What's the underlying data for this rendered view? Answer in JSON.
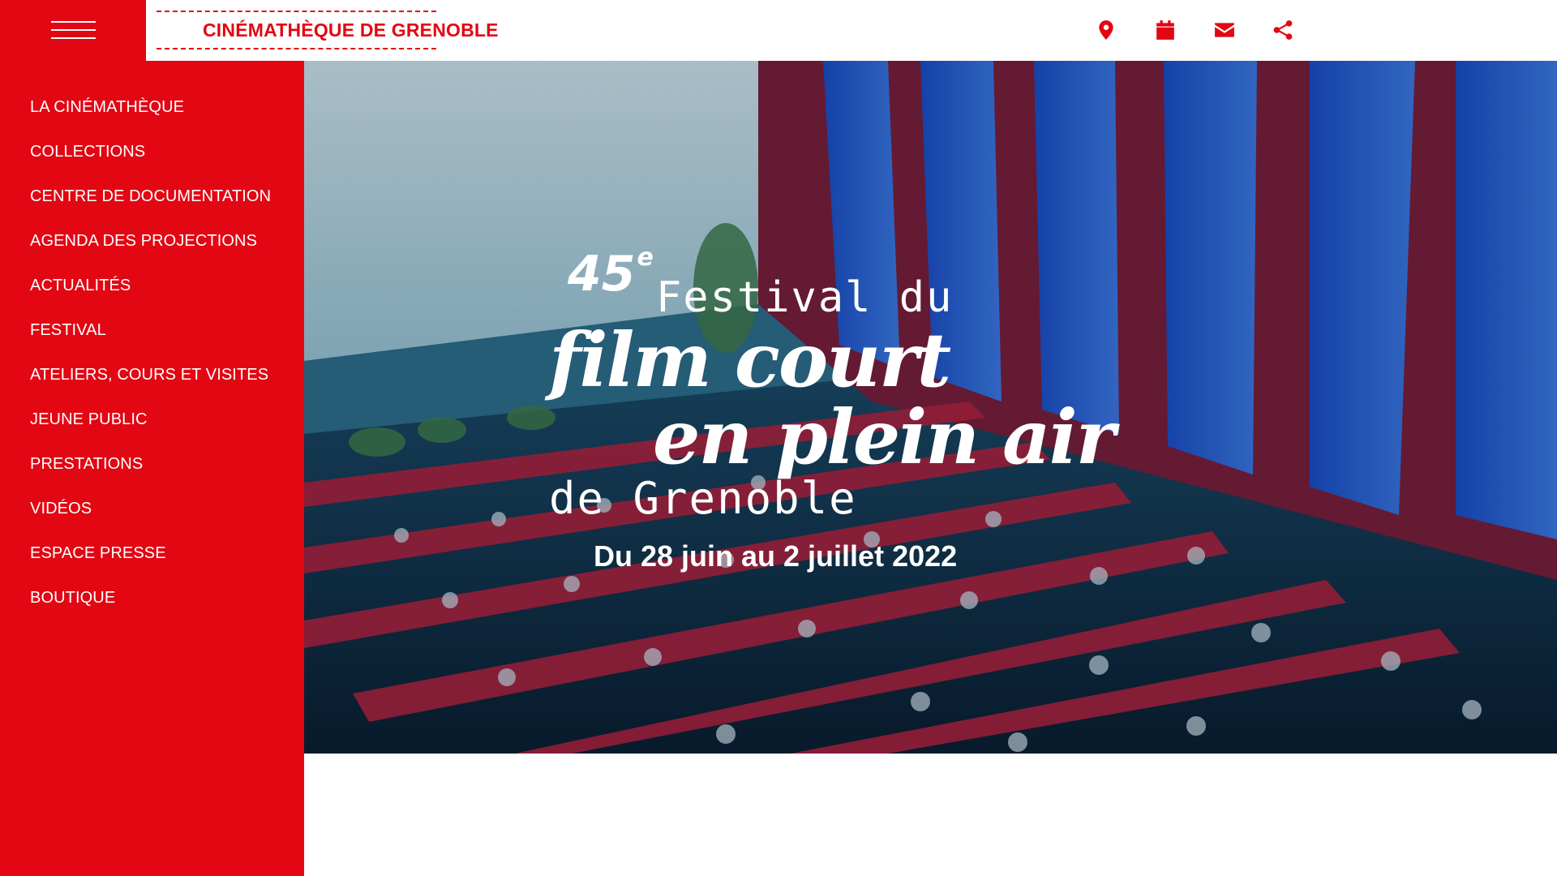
{
  "header": {
    "logo_text": "CINÉMATHÈQUE DE GRENOBLE",
    "icons": [
      "map-marker-icon",
      "calendar-icon",
      "envelope-icon",
      "share-icon"
    ],
    "accent_color": "#e30613"
  },
  "sidebar": {
    "items": [
      {
        "label": "LA CINÉMATHÈQUE"
      },
      {
        "label": "COLLECTIONS"
      },
      {
        "label": "CENTRE DE DOCUMENTATION"
      },
      {
        "label": "AGENDA DES PROJECTIONS"
      },
      {
        "label": "ACTUALITÉS"
      },
      {
        "label": "FESTIVAL"
      },
      {
        "label": "ATELIERS, COURS ET VISITES"
      },
      {
        "label": "JEUNE PUBLIC"
      },
      {
        "label": "PRESTATIONS"
      },
      {
        "label": "VIDÉOS"
      },
      {
        "label": "ESPACE PRESSE"
      },
      {
        "label": "BOUTIQUE"
      }
    ]
  },
  "hero": {
    "edition_number": "45",
    "edition_suffix": "e",
    "line1": "Festival du",
    "line2": "film court",
    "line3": "en plein air",
    "line4": "de Grenoble",
    "dates": "Du 28 juin au 2 juillet 2022"
  }
}
